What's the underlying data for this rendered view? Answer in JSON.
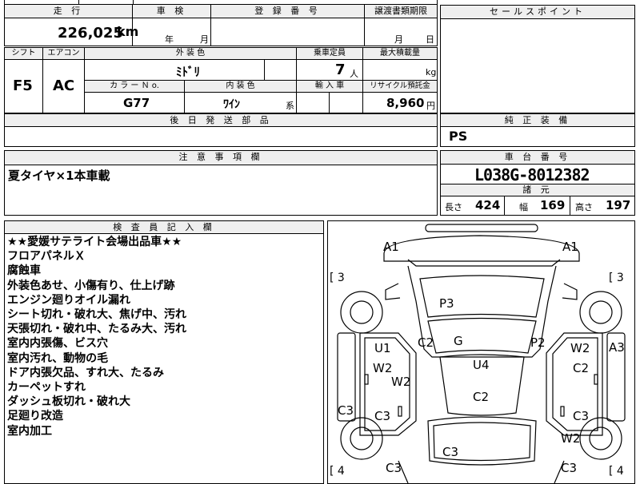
{
  "top_section": {
    "headers": {
      "mileage": "走 行",
      "inspection": "車 検",
      "registration_number": "登 録 番 号",
      "transfer_deadline": "譲渡書類期限",
      "sales_point": "セールスポイント"
    },
    "mileage_value": "226,025",
    "mileage_unit": "km",
    "inspection_year_unit": "年",
    "inspection_month_unit": "月",
    "transfer_month_unit": "月",
    "transfer_day_unit": "日"
  },
  "second_section": {
    "headers": {
      "shift": "シフト",
      "aircon": "エアコン",
      "exterior_color": "外 装 色",
      "capacity": "乗車定員",
      "max_load": "最大積載量",
      "color_no": "カ ラ ー Ｎ o.",
      "interior_color": "内 装 色",
      "import": "輸 入 車",
      "recycle_fee": "リサイクル預託金"
    },
    "shift_value": "F5",
    "aircon_value": "AC",
    "exterior_color_value": "ﾐﾄﾞﾘ",
    "capacity_value": "7",
    "capacity_unit": "人",
    "max_load_unit": "kg",
    "color_no_value": "G77",
    "interior_color_value": "ﾜｲﾝ",
    "interior_color_suffix": "系",
    "recycle_fee_value": "8,960",
    "recycle_fee_unit": "円"
  },
  "parts_section": {
    "header": "後 日 発 送 部 品",
    "value": ""
  },
  "equipment": {
    "header": "純 正 装 備",
    "value": "PS"
  },
  "caution": {
    "header": "注 意 事 項 欄",
    "value": "夏タイヤ×1本車載"
  },
  "chassis": {
    "header": "車 台 番 号",
    "value": "L038G-8012382",
    "specs_header": "諸 元",
    "length_label": "長さ",
    "length_value": "424",
    "width_label": "幅",
    "width_value": "169",
    "height_label": "高さ",
    "height_value": "197"
  },
  "inspector": {
    "header": "検 査 員 記 入 欄",
    "lines": [
      "★★愛媛サテライト会場出品車★★",
      "フロアパネルＸ",
      "腐蝕車",
      "外装色あせ、小傷有り、仕上げ跡",
      "エンジン廻りオイル漏れ",
      "シート切れ・破れ大、焦げ中、汚れ",
      "天張切れ・破れ中、たるみ大、汚れ",
      "室内内張傷、ビス穴",
      "室内汚れ、動物の毛",
      "ドア内張欠品、すれ大、たるみ",
      "カーペットすれ",
      "ダッシュ板切れ・破れ大",
      "足廻り改造",
      "室内加工"
    ]
  },
  "diagram": {
    "tire_marks": [
      "[ 3",
      "[ 3",
      "[ 4",
      "[ 4"
    ],
    "damage_codes": [
      "A1",
      "A1",
      "P3",
      "C2",
      "G",
      "P2",
      "U1",
      "W2",
      "A3",
      "U4",
      "W2",
      "C2",
      "W2",
      "C2",
      "C3",
      "C3",
      "C3",
      "W2",
      "C3",
      "C3",
      "C3"
    ]
  }
}
